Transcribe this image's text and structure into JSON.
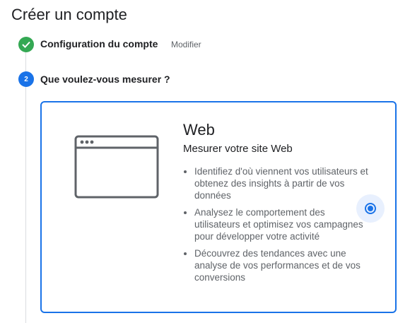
{
  "page": {
    "title": "Créer un compte"
  },
  "steps": [
    {
      "label": "Configuration du compte",
      "status": "done",
      "action": "Modifier"
    },
    {
      "number": "2",
      "label": "Que voulez-vous mesurer ?",
      "status": "active"
    }
  ],
  "options": [
    {
      "title": "Web",
      "subtitle": "Mesurer votre site Web",
      "icon": "browser-window-icon",
      "selected": true,
      "bullets": [
        "Identifiez d'où viennent vos utilisateurs et obtenez des insights à partir de vos données",
        "Analysez le comportement des utilisateurs et optimisez vos campagnes pour développer votre activité",
        "Découvrez des tendances avec une analyse de vos performances et de vos conversions"
      ]
    }
  ],
  "colors": {
    "accent": "#1a73e8",
    "success": "#34a853",
    "muted": "#5f6368"
  }
}
